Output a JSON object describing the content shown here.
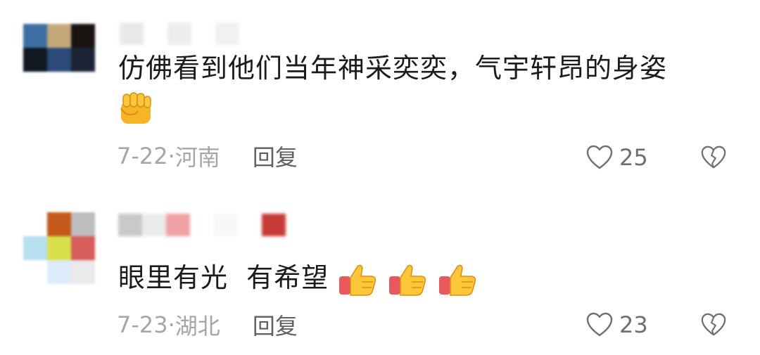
{
  "comments": [
    {
      "text": "仿佛看到他们当年神采奕奕，气宇轩昂的身姿",
      "emoji": "raised-fist-emoji",
      "date": "7-22",
      "separator": "·",
      "location": "河南",
      "reply_label": "回复",
      "likes": "25",
      "avatar_colors": [
        "#3f6ea2",
        "#c3a87a",
        "#1b1512",
        "#111820",
        "#2b4a78",
        "#1d2436"
      ],
      "username_colors": [
        "#e9e9e9",
        "#ffffff",
        "#eeeeee",
        "#ffffff",
        "#f1f1f1"
      ]
    },
    {
      "text": "眼里有光  有希望",
      "emoji": "thumbs-up-emoji",
      "emoji_count": 3,
      "date": "7-23",
      "separator": "·",
      "location": "湖北",
      "reply_label": "回复",
      "likes": "23",
      "avatar_colors": [
        "#ffffff",
        "#c5591c",
        "#bdbdbd",
        "#b7dff0",
        "#d8e04b",
        "#d85d5d",
        "#ffffff",
        "#dcebf9",
        "#eaeaea"
      ],
      "username_colors": [
        "#c9c9c9",
        "#ebebeb",
        "#f0a1a4",
        "#ffffff",
        "#f7f7f7",
        "#ffffff",
        "#c63a37"
      ]
    }
  ],
  "icons": {
    "like": "heart-outline-icon",
    "dislike": "broken-heart-icon"
  }
}
